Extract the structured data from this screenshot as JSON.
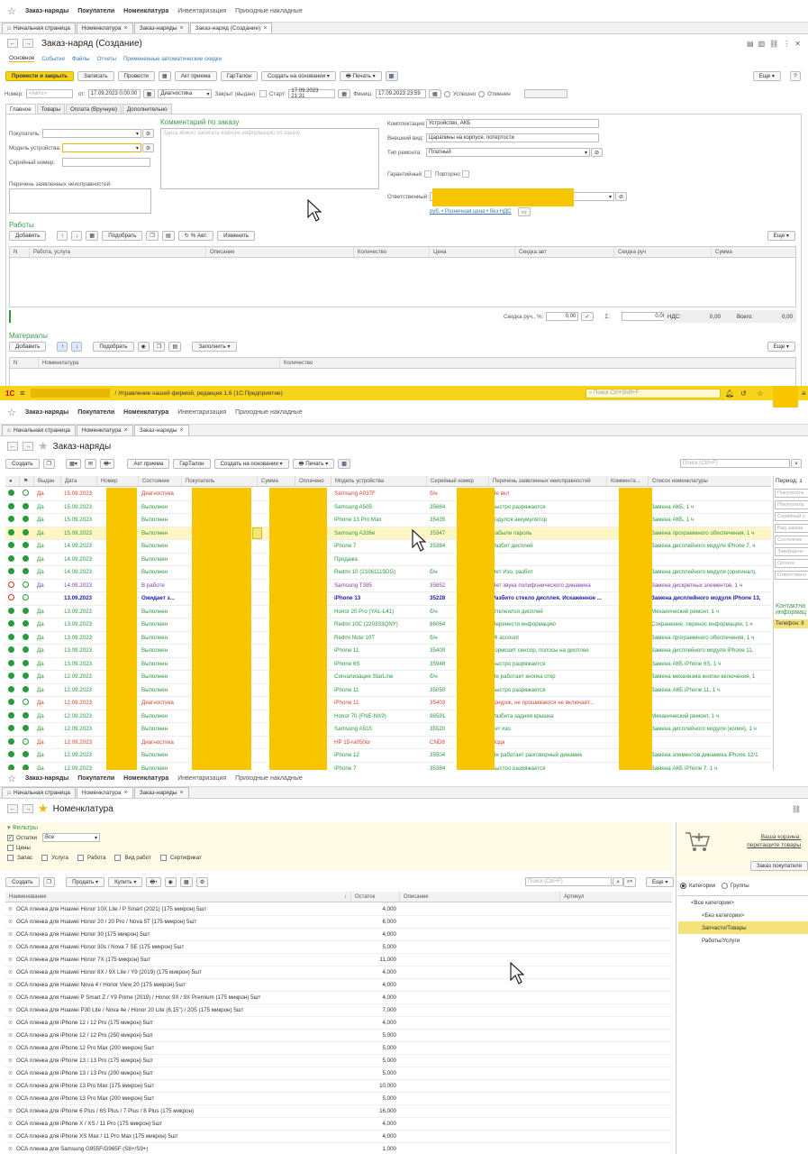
{
  "p1": {
    "topnav": [
      "Заказ-наряды",
      "Покупатели",
      "Номенклатура",
      "Инвентаризация",
      "Приходные накладные"
    ],
    "tabs": [
      "Начальная страница",
      "Номенклатура",
      "Заказ-наряды",
      "Заказ-наряд (Создание)"
    ],
    "title": "Заказ-наряд (Создание)",
    "subtabs": [
      "Основное",
      "События",
      "Файлы",
      "Отчеты",
      "Примененные автоматические скидки"
    ],
    "toolbar": {
      "post_close": "Провести и закрыть",
      "save": "Записать",
      "post": "Провести",
      "act": "Акт приема",
      "guarantee": "ГарТалон",
      "create_based": "Создать на основании",
      "print": "Печать",
      "more": "Еще",
      "help": "?"
    },
    "header": {
      "number_label": "Номер:",
      "number_placeholder": "<Авто>",
      "from_label": "от:",
      "date": "17.09.2023  0:00:00",
      "state": "Диагностика",
      "closed_label": "Закрыт (выдан):",
      "start_label": "Старт:",
      "start": "17.09.2023 21:31",
      "finish_label": "Финиш:",
      "finish": "17.09.2023 23:59",
      "success_label": "Успешно",
      "cancel_label": "Отменен"
    },
    "formtabs": [
      "Главное",
      "Товары",
      "Оплата (Вручную)",
      "Дополнительно"
    ],
    "left": {
      "buyer_label": "Покупатель:",
      "model_label": "Модель устройства:",
      "serial_label": "Серийный номер:",
      "faults_label": "Перечень заявленных неисправностей:"
    },
    "comment": {
      "label": "Комментарий по заказу",
      "placeholder": "Здесь можно записать важную информацию по заказу"
    },
    "right": {
      "kit_label": "Комплектация:",
      "kit": "Устройство, АКБ",
      "look_label": "Внешний вид:",
      "look": "Царапины на корпусе, потертости",
      "repair_label": "Тип ремонта:",
      "repair": "Платный",
      "warranty_label": "Гарантийный:",
      "repeat_label": "Повторно:",
      "resp_label": "Ответственный:",
      "price_link": "руб. • Розничная цена • без НДС"
    },
    "works": {
      "title": "Работы",
      "add": "Добавить",
      "pick": "Подобрать",
      "auto": "% Авт.",
      "change": "Изменить",
      "more": "Еще",
      "columns": [
        "N",
        "Работа, услуга",
        "Описание",
        "Количество",
        "Цена",
        "Скидка авт",
        "Скидка руч",
        "Сумма"
      ]
    },
    "totals": {
      "disc_label": "Скидка руч., %:",
      "disc": "0,00",
      "sum_label": "Σ:",
      "sum": "0,00",
      "vat_label": "НДС:",
      "vat": "0,00",
      "total_label": "Всего:",
      "total": "0,00"
    },
    "materials": {
      "title": "Материалы",
      "add": "Добавить",
      "pick": "Подобрать",
      "fill": "Заполнить",
      "more": "Еще",
      "columns": [
        "N",
        "Номенклатура",
        "Количество"
      ]
    }
  },
  "p2": {
    "appbar": "/ Управление нашей фирмой, редакция 1.6  (1С:Предприятие)",
    "search_top": "Поиск Ctrl+Shift+F",
    "topnav": [
      "Заказ-наряды",
      "Покупатели",
      "Номенклатура",
      "Инвентаризация",
      "Приходные накладные"
    ],
    "tabs": [
      "Начальная страница",
      "Номенклатура",
      "Заказ-наряды"
    ],
    "title": "Заказ-наряды",
    "toolbar": {
      "create": "Создать",
      "act": "Акт приема",
      "guarantee": "ГарТалон",
      "create_based": "Создать на основании",
      "print": "Печать",
      "search": "Поиск (Ctrl+F)"
    },
    "columns": [
      "Выдан",
      "Дата",
      "Номер",
      "Состояние",
      "Покупатель",
      "Сумма",
      "Оплачено",
      "Модель устройства",
      "Серийный номер",
      "Перечень заявленных неисправностей",
      "Коммента...",
      "Список номенклатуры"
    ],
    "side": {
      "period": "Период: з",
      "fields": [
        "Покупатель",
        "Покупатель",
        "Серийный н",
        "Вид заказа",
        "Состояние",
        "Завершенн",
        "Оплата",
        "Ответственн"
      ],
      "contacts": "Контактна информац",
      "phone": "Телефон: 8"
    },
    "rows": [
      {
        "st": "g",
        "st2": "o",
        "given": "Да",
        "date": "15.09.2023",
        "state": "Диагностика",
        "sc": "diag",
        "paid": "",
        "model": "Samsung A037F",
        "serial": "б/н",
        "fault": "Не вкл",
        "list": ""
      },
      {
        "st": "g",
        "st2": "g",
        "given": "Да",
        "date": "15.09.2023",
        "state": "Выполнен",
        "sc": "ok",
        "paid": ",00",
        "model": "Samsung A505",
        "serial": "35664",
        "fault": "Быстро разряжается",
        "list": "Замена АКБ, 1 ч"
      },
      {
        "st": "g",
        "st2": "g",
        "given": "Да",
        "date": "15.09.2023",
        "state": "Выполнен",
        "sc": "ok",
        "paid": ",00",
        "model": "iPhone 13 Pro Max",
        "serial": "35435",
        "fault": "Вздулся аккумулятор",
        "list": "Замена АКБ, 1 ч"
      },
      {
        "st": "g",
        "st2": "g",
        "given": "Да",
        "date": "15.09.2023",
        "state": "Выполнен",
        "sc": "ok",
        "paid": ",00",
        "model": "Samsung A336e",
        "serial": "35347",
        "fault": "Забыли пароль",
        "list": "Замена программного обеспечения, 1 ч",
        "sel": true
      },
      {
        "st": "g",
        "st2": "g",
        "given": "Да",
        "date": "14.09.2023",
        "state": "Выполнен",
        "sc": "ok",
        "paid": ",00",
        "model": "iPhone 7",
        "serial": "35384",
        "fault": "Разбит дисплей",
        "list": "Замена дисплейного модуля iPhone 7, ч"
      },
      {
        "st": "g",
        "st2": "g",
        "given": "Да",
        "date": "14.09.2023",
        "state": "Выполнен",
        "sc": "ok",
        "paid": ",00",
        "model": "Продажа",
        "serial": "",
        "fault": "",
        "list": ""
      },
      {
        "st": "g",
        "st2": "g",
        "given": "Да",
        "date": "14.09.2023",
        "state": "Выполнен",
        "sc": "ok",
        "paid": ",00",
        "model": "Redmi 10 (21061119DG)",
        "serial": "б/н",
        "fault": "Нет Изо, разбит",
        "list": "Замена дисплейного модуля (оригинал),"
      },
      {
        "st": "r",
        "st2": "o",
        "given": "Да",
        "date": "14.09.2023",
        "state": "В работе",
        "sc": "work",
        "paid": ",00",
        "model": "Samsung T385",
        "serial": "35852",
        "fault": "Нет звука полифонического динамика",
        "list": "Замена дискретных элементов, 1 ч"
      },
      {
        "st": "r",
        "st2": "o",
        "given": "",
        "date": "13.09.2023",
        "state": "Ожидает з...",
        "sc": "wait",
        "paid": ",00",
        "model": "iPhone 13",
        "serial": "35228",
        "fault": "Разбито стекло дисплея. Искаженное ...",
        "list": "Замена дисплейного модуля iPhone 13,",
        "bold": true
      },
      {
        "st": "g",
        "st2": "g",
        "given": "Да",
        "date": "13.09.2023",
        "state": "Выполнен",
        "sc": "ok",
        "paid": ",00",
        "model": "Honor 20 Pro (YAL-L41)",
        "serial": "б/н",
        "fault": "Отклеился дисплей",
        "list": "Механический ремонт, 1 ч"
      },
      {
        "st": "g",
        "st2": "g",
        "given": "Да",
        "date": "13.09.2023",
        "state": "Выполнен",
        "sc": "ok",
        "paid": ",00",
        "model": "Redmi 10C (220333QNY)",
        "serial": "86064",
        "fault": "Перенести информацию",
        "list": "Сохранение, перенос информации, 1 ч"
      },
      {
        "st": "g",
        "st2": "g",
        "given": "Да",
        "date": "13.09.2023",
        "state": "Выполнен",
        "sc": "ok",
        "paid": ",00",
        "model": "Redmi Note 10T",
        "serial": "б/н",
        "fault": "Mi account",
        "list": "Замена программного обеспечения, 1 ч"
      },
      {
        "st": "g",
        "st2": "g",
        "given": "Да",
        "date": "13.09.2023",
        "state": "Выполнен",
        "sc": "ok",
        "paid": ",00",
        "model": "iPhone 11",
        "serial": "35400",
        "fault": "Тормозит сенсор, полосы на дисплее",
        "list": "Замена дисплейного модуля iPhone 11,"
      },
      {
        "st": "g",
        "st2": "g",
        "given": "Да",
        "date": "13.09.2023",
        "state": "Выполнен",
        "sc": "ok",
        "paid": ",00",
        "model": "iPhone 6S",
        "serial": "35948",
        "fault": "Быстро разряжается",
        "list": "Замена АКБ iPhone 6S, 1 ч"
      },
      {
        "st": "g",
        "st2": "g",
        "given": "Да",
        "date": "12.09.2023",
        "state": "Выполнен",
        "sc": "ok",
        "paid": ",00",
        "model": "Сигнализация StarLine",
        "serial": "б/н",
        "fault": "Не работает кнопка откр",
        "list": "Замена механизма кнопки включения, 1"
      },
      {
        "st": "g",
        "st2": "g",
        "given": "Да",
        "date": "12.09.2023",
        "state": "Выполнен",
        "sc": "ok",
        "paid": ",00",
        "model": "iPhone 11",
        "serial": "35050",
        "fault": "Быстро разряжается",
        "list": "Замена АКБ iPhone 11, 1 ч"
      },
      {
        "st": "g",
        "st2": "o",
        "given": "Да",
        "date": "12.09.2023",
        "state": "Диагностика",
        "sc": "diag",
        "paid": "",
        "model": "iPhone 11",
        "serial": "35403",
        "fault": "Шнурок, не прошивается не включает...",
        "list": ""
      },
      {
        "st": "g",
        "st2": "g",
        "given": "Да",
        "date": "12.09.2023",
        "state": "Выполнен",
        "sc": "ok",
        "paid": ",00",
        "model": "Honor 70 (FNE-NX9)",
        "serial": "86591",
        "fault": "Разбита задняя крышка",
        "list": "Механический ремонт, 1 ч"
      },
      {
        "st": "g",
        "st2": "g",
        "given": "Да",
        "date": "12.09.2023",
        "state": "Выполнен",
        "sc": "ok",
        "paid": ",00",
        "model": "Samsung A515",
        "serial": "35520",
        "fault": "нет изо",
        "list": "Замена дисплейного модуля (копия), 1 ч"
      },
      {
        "st": "g",
        "st2": "o",
        "given": "Да",
        "date": "12.09.2023",
        "state": "Диагностика",
        "sc": "diag",
        "paid": "",
        "model": "HP 15-ra050ur",
        "serial": "CND8",
        "fault": "Вода",
        "list": ""
      },
      {
        "st": "g",
        "st2": "g",
        "given": "Да",
        "date": "12.09.2023",
        "state": "Выполнен",
        "sc": "ok",
        "paid": ",00",
        "model": "iPhone 12",
        "serial": "35504",
        "fault": "Не работает разговорный динамик",
        "list": "Замена элементов динамика iPhone 12/1"
      },
      {
        "st": "g",
        "st2": "g",
        "given": "Да",
        "date": "12.09.2023",
        "state": "Выполнен",
        "sc": "ok",
        "paid": ",00",
        "model": "iPhone 7",
        "serial": "35384",
        "fault": "Быстро разряжается",
        "list": "Замена АКБ iPhone 7, 1 ч"
      }
    ]
  },
  "p3": {
    "topnav": [
      "Заказ-наряды",
      "Покупатели",
      "Номенклатура",
      "Инвентаризация",
      "Приходные накладные"
    ],
    "tabs": [
      "Начальная страница",
      "Номенклатура",
      "Заказ-наряды"
    ],
    "title": "Номенклатура",
    "filters": {
      "title": "Фильтры",
      "stock_label": "Остатки",
      "stock_value": "Все",
      "prices_label": "Цены",
      "checks": [
        "Запас",
        "Услуга",
        "Работа",
        "Вид работ",
        "Сертификат"
      ]
    },
    "toolbar": {
      "create": "Создать",
      "sell": "Продать",
      "buy": "Купить",
      "search": "Поиск (Ctrl+F)",
      "more": "Еще"
    },
    "cart": {
      "title": "Ваша корзина:",
      "hint": "перетащите товары",
      "order": "Заказ покупателя"
    },
    "cat_radio": [
      "Категории",
      "Группы"
    ],
    "categories": [
      "<Все категории>",
      "<Без категории>",
      "Запчасти/Товары",
      "Работы/Услуги"
    ],
    "columns": [
      "Наименование",
      "Остаток",
      "Описание",
      "Артикул"
    ],
    "items": [
      {
        "name": "ОСА пленка для Huawei Honor 10X Lite / P Smart (2021) (175 микрон) 5шт",
        "qty": "4,000"
      },
      {
        "name": "ОСА пленка для Huawei Honor 20 / 20 Pro / Nova 5T (175 микрон) 5шт",
        "qty": "6,000"
      },
      {
        "name": "ОСА пленка для Huawei Honor 30 (175 микрон) 5шт",
        "qty": "4,000"
      },
      {
        "name": "ОСА пленка для Huawei Honor 30s / Nova 7 SE (175 микрон) 5шт",
        "qty": "5,000"
      },
      {
        "name": "ОСА пленка для Huawei Honor 7X (175 микрон) 5шт",
        "qty": "11,000"
      },
      {
        "name": "ОСА пленка для Huawei Honor 8X / 9X Lite / Y9 (2019) (175 микрон) 5шт",
        "qty": "4,000"
      },
      {
        "name": "ОСА пленка для Huawei Nova 4 / Honor View 20 (175 микрон) 5шт",
        "qty": "4,000"
      },
      {
        "name": "ОСА пленка для Huawei P Smart Z / Y9 Prime (2019) / Honor 9X / 9X Premium (175 микрон) 5шт",
        "qty": "4,000"
      },
      {
        "name": "ОСА пленка для Huawei P30 Lite / Nova 4e / Honor 20 Lite (6,15\") / 20S (175 микрон) 5шт",
        "qty": "7,000"
      },
      {
        "name": "ОСА пленка для iPhone 12 / 12 Pro (175 микрон) 5шт",
        "qty": "4,000"
      },
      {
        "name": "ОСА пленка для iPhone 12 / 12 Pro (250 микрон) 5шт",
        "qty": "5,000"
      },
      {
        "name": "ОСА пленка для iPhone 12 Pro Max (200 микрон) 5шт",
        "qty": "5,000"
      },
      {
        "name": "ОСА пленка для iPhone 13 / 13 Pro (175 микрон) 5шт",
        "qty": "5,000"
      },
      {
        "name": "ОСА пленка для iPhone 13 / 13 Pro (200 микрон) 5шт",
        "qty": "5,000"
      },
      {
        "name": "ОСА пленка для iPhone 13 Pro Max (175 микрон) 5шт",
        "qty": "10,000"
      },
      {
        "name": "ОСА пленка для iPhone 13 Pro Max (200 микрон) 5шт",
        "qty": "5,000"
      },
      {
        "name": "ОСА пленка для iPhone 6 Plus / 6S Plus / 7 Plus / 8 Plus (175 микрон)",
        "qty": "16,000"
      },
      {
        "name": "ОСА пленка для iPhone X / XS / 11 Pro (175 микрон) 5шт",
        "qty": "4,000"
      },
      {
        "name": "ОСА пленка для iPhone XS Max / 11 Pro Max (175 микрон) 5шт",
        "qty": "4,000"
      },
      {
        "name": "ОСА пленка для Samsung G955F/G965F (S8+/S9+)",
        "qty": "1,000"
      }
    ]
  },
  "colors": {
    "accent": "#f7d41c",
    "green": "#2a9a3b",
    "redact": "#f7c600",
    "selrow": "#fff6c6"
  }
}
